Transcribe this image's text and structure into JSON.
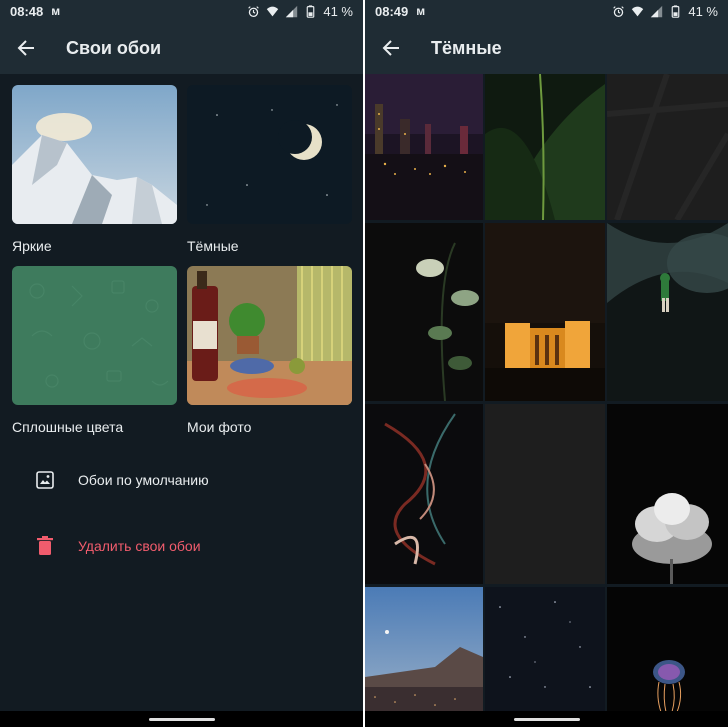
{
  "left": {
    "status": {
      "time": "08:48",
      "battery": "41 %"
    },
    "title": "Свои обои",
    "categories": [
      {
        "label": "Яркие"
      },
      {
        "label": "Тёмные"
      },
      {
        "label": "Сплошные цвета"
      },
      {
        "label": "Мои фото"
      }
    ],
    "menu": [
      {
        "label": "Обои по умолчанию",
        "icon": "image-icon"
      },
      {
        "label": "Удалить свои обои",
        "icon": "trash-icon",
        "color": "#f15c6d"
      }
    ]
  },
  "right": {
    "status": {
      "time": "08:49",
      "battery": "41 %"
    },
    "title": "Тёмные",
    "wallpapers": [
      "city-skyline-night",
      "green-leaf",
      "dark-stone-texture",
      "dark-plant",
      "illuminated-temple",
      "cave-climber",
      "light-trails",
      "dark-texture",
      "white-flower",
      "twilight-mountain-city",
      "starry-sky",
      "jellyfish"
    ]
  },
  "colors": {
    "background": "#121b22",
    "appbar": "#1f2c34",
    "text": "#e9edef",
    "danger": "#f15c6d",
    "solid_green": "#3e7b5d"
  }
}
